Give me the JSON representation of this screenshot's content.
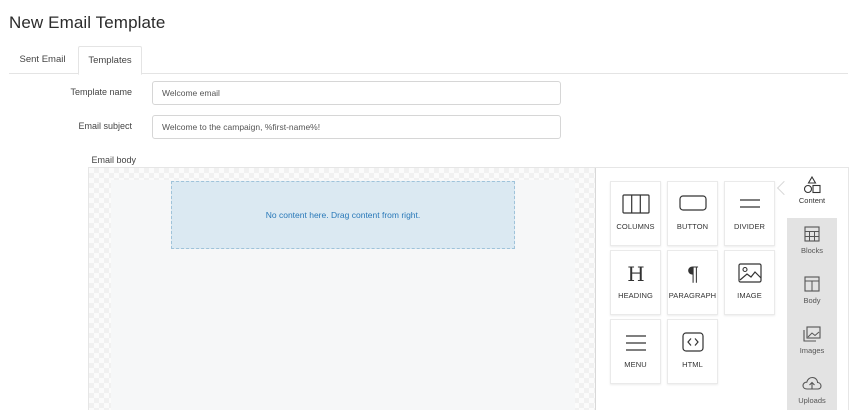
{
  "page": {
    "title": "New Email Template"
  },
  "tabs": [
    {
      "label": "Sent Email"
    },
    {
      "label": "Templates"
    }
  ],
  "form": {
    "template_name": {
      "label": "Template name",
      "value": "Welcome email"
    },
    "email_subject": {
      "label": "Email subject",
      "value": "Welcome to the campaign, %first-name%!"
    },
    "email_body": {
      "label": "Email body"
    }
  },
  "editor": {
    "dropzone_text": "No content here. Drag content from right.",
    "tools": [
      {
        "label": "COLUMNS",
        "icon": "columns-icon"
      },
      {
        "label": "BUTTON",
        "icon": "button-icon"
      },
      {
        "label": "DIVIDER",
        "icon": "divider-icon"
      },
      {
        "label": "HEADING",
        "icon": "heading-icon"
      },
      {
        "label": "PARAGRAPH",
        "icon": "paragraph-icon"
      },
      {
        "label": "IMAGE",
        "icon": "image-icon"
      },
      {
        "label": "MENU",
        "icon": "menu-icon"
      },
      {
        "label": "HTML",
        "icon": "html-icon"
      }
    ],
    "sidebar": [
      {
        "label": "Content",
        "icon": "shapes-icon",
        "active": true
      },
      {
        "label": "Blocks",
        "icon": "blocks-icon"
      },
      {
        "label": "Body",
        "icon": "body-icon"
      },
      {
        "label": "Images",
        "icon": "images-icon"
      },
      {
        "label": "Uploads",
        "icon": "upload-cloud-icon"
      }
    ]
  }
}
